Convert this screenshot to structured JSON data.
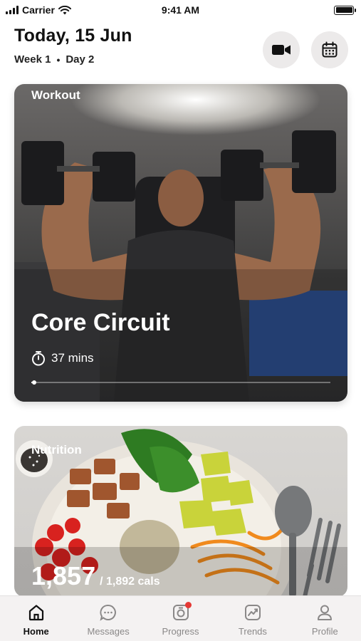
{
  "status_bar": {
    "carrier": "Carrier",
    "time": "9:41 AM"
  },
  "header": {
    "date": "Today, 15 Jun",
    "week": "Week 1",
    "day": "Day 2",
    "separator": "•",
    "video_icon": "video-camera-icon",
    "calendar_icon": "calendar-icon"
  },
  "workout": {
    "label": "Workout",
    "title": "Core Circuit",
    "duration": "37 mins",
    "progress": 0.01
  },
  "nutrition": {
    "label": "Nutrition",
    "calories": "1,857",
    "target": "/ 1,892 cals"
  },
  "tabs": [
    {
      "label": "Home",
      "icon": "home-icon",
      "active": true
    },
    {
      "label": "Messages",
      "icon": "chat-icon",
      "active": false
    },
    {
      "label": "Progress",
      "icon": "camera-icon",
      "active": false,
      "badge": true
    },
    {
      "label": "Trends",
      "icon": "trend-chart-icon",
      "active": false
    },
    {
      "label": "Profile",
      "icon": "user-icon",
      "active": false
    }
  ],
  "colors": {
    "accent": "#111111",
    "badge": "#e53935",
    "tab_inactive": "#8a8888"
  }
}
